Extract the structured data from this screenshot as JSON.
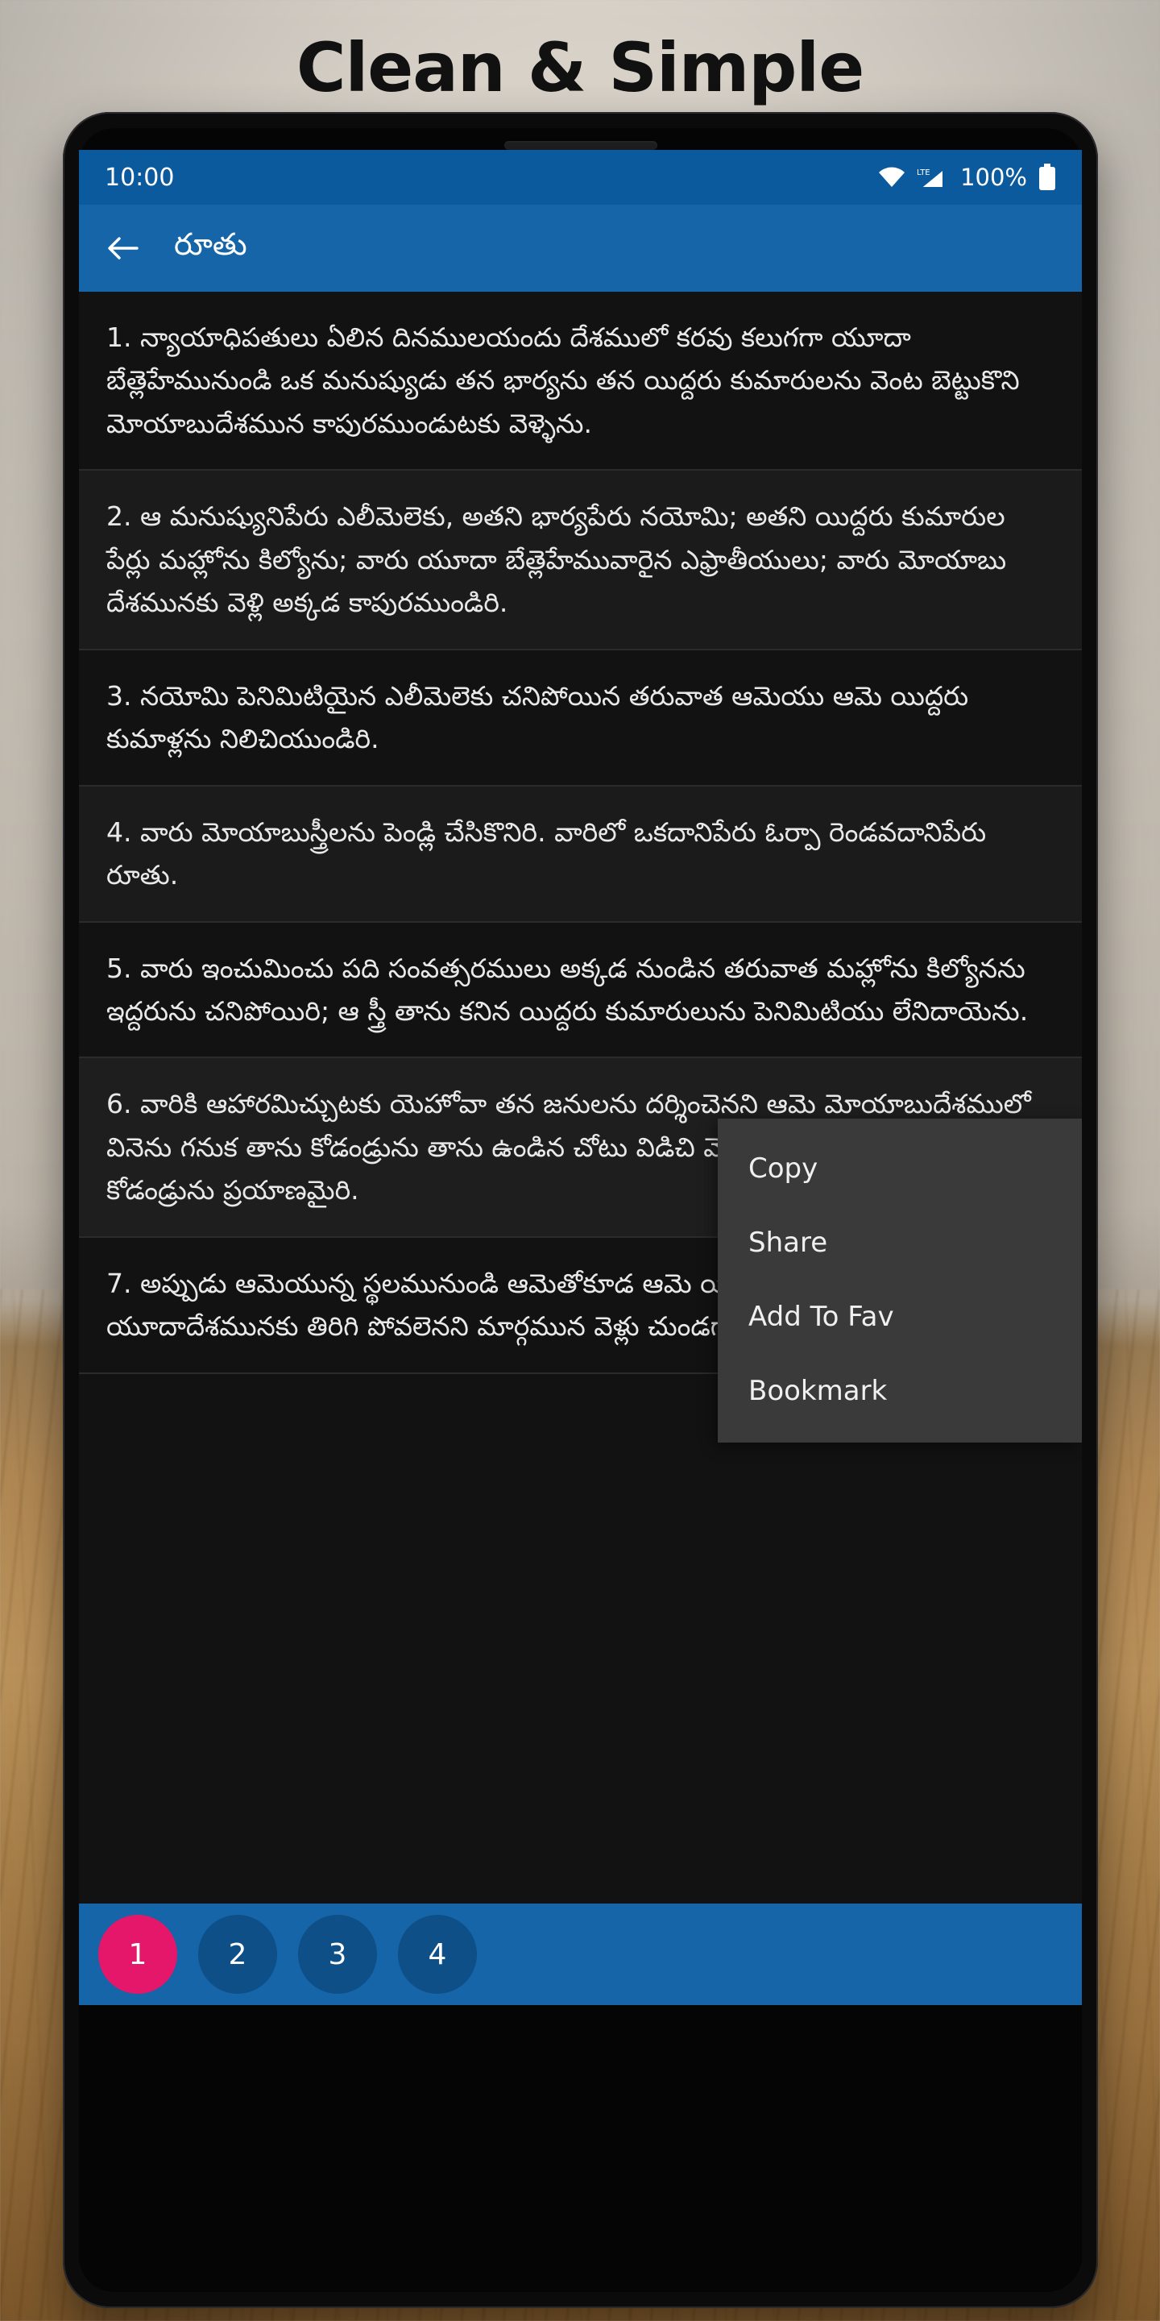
{
  "headline": "Clean & Simple",
  "phone": {
    "statusbar": {
      "time": "10:00",
      "wifi_icon": "wifi-icon",
      "signal_icon": "lte-signal-icon",
      "network_label": "LTE",
      "battery_text": "100%",
      "battery_icon": "battery-full-icon"
    },
    "appbar": {
      "back_icon": "back-arrow-icon",
      "title": "రూతు"
    },
    "verses": [
      {
        "number": "1.",
        "text": "1.  న్యాయాధిపతులు ఏలిన దినములయందు దేశములో కరవు కలుగగా యూదా బేత్లెహేమునుండి ఒక మనుష్యుడు తన భార్యను తన యిద్దరు కుమారులను వెంట బెట్టుకొని మోయాబుదేశమున కాపురముండుటకు వెళ్ళెను."
      },
      {
        "number": "2.",
        "text": "2. ఆ మనుష్యునిపేరు ఎలీమెలెకు, అతని భార్యపేరు నయోమి; అతని యిద్దరు కుమారుల పేర్లు మహ్లోను కిల్యోను; వారు యూదా బేత్లెహేమువారైన ఎఫ్రాతీయులు; వారు మోయాబు దేశమునకు వెళ్లి అక్కడ కాపురముండిరి."
      },
      {
        "number": "3.",
        "text": "3. నయోమి పెనిమిటియైన ఎలీమెలెకు చనిపోయిన తరువాత ఆమెయు ఆమె యిద్దరు కుమాళ్లను నిలిచియుండిరి."
      },
      {
        "number": "4.",
        "text": "4. వారు మోయాబుస్త్రీలను పెండ్లి చేసికొనిరి. వారిలో ఒకదానిపేరు ఓర్పా రెండవదానిపేరు రూతు."
      },
      {
        "number": "5.",
        "text": "5. వారు ఇంచుమించు పది సంవత్సరములు అక్కడ నుండిన తరువాత మహ్లోను కిల్యోనను ఇద్దరును చనిపోయిరి; ఆ స్త్రీ తాను కనిన యిద్దరు కుమారులును పెనిమిటియు లేనిదాయెను."
      },
      {
        "number": "6.",
        "text": "6. వారికి ఆహారమిచ్చుటకు యెహోవా తన జనులను దర్శించెనని ఆమె మోయాబుదేశములో వినెను గనుక తాను కోడండ్రును తాను ఉండిన చోటు విడిచి వెళ్లుటకై ఆమెయు ఆమె కోడండ్రును ప్రయాణమైరి."
      },
      {
        "number": "7.",
        "text": "7. అప్పుడు ఆమెయున్న స్థలమునుండి ఆమెతోకూడ ఆమె యిద్దరు కోడండ్రును బయలుదేరీ యూదాదేశమునకు తిరిగి పోవలెనని మార్గమున వెళ్లు చుండగా"
      }
    ],
    "context_menu": {
      "items": [
        {
          "label": "Copy"
        },
        {
          "label": "Share"
        },
        {
          "label": "Add To Fav"
        },
        {
          "label": "Bookmark"
        }
      ]
    },
    "pager": {
      "pages": [
        {
          "label": "1",
          "active": true
        },
        {
          "label": "2",
          "active": false
        },
        {
          "label": "3",
          "active": false
        },
        {
          "label": "4",
          "active": false
        }
      ]
    }
  },
  "colors": {
    "status_bar": "#0c5a9e",
    "app_bar": "#1565a8",
    "accent_pink": "#e5176b",
    "screen_bg": "#121212",
    "menu_bg": "#3a3a3a"
  }
}
